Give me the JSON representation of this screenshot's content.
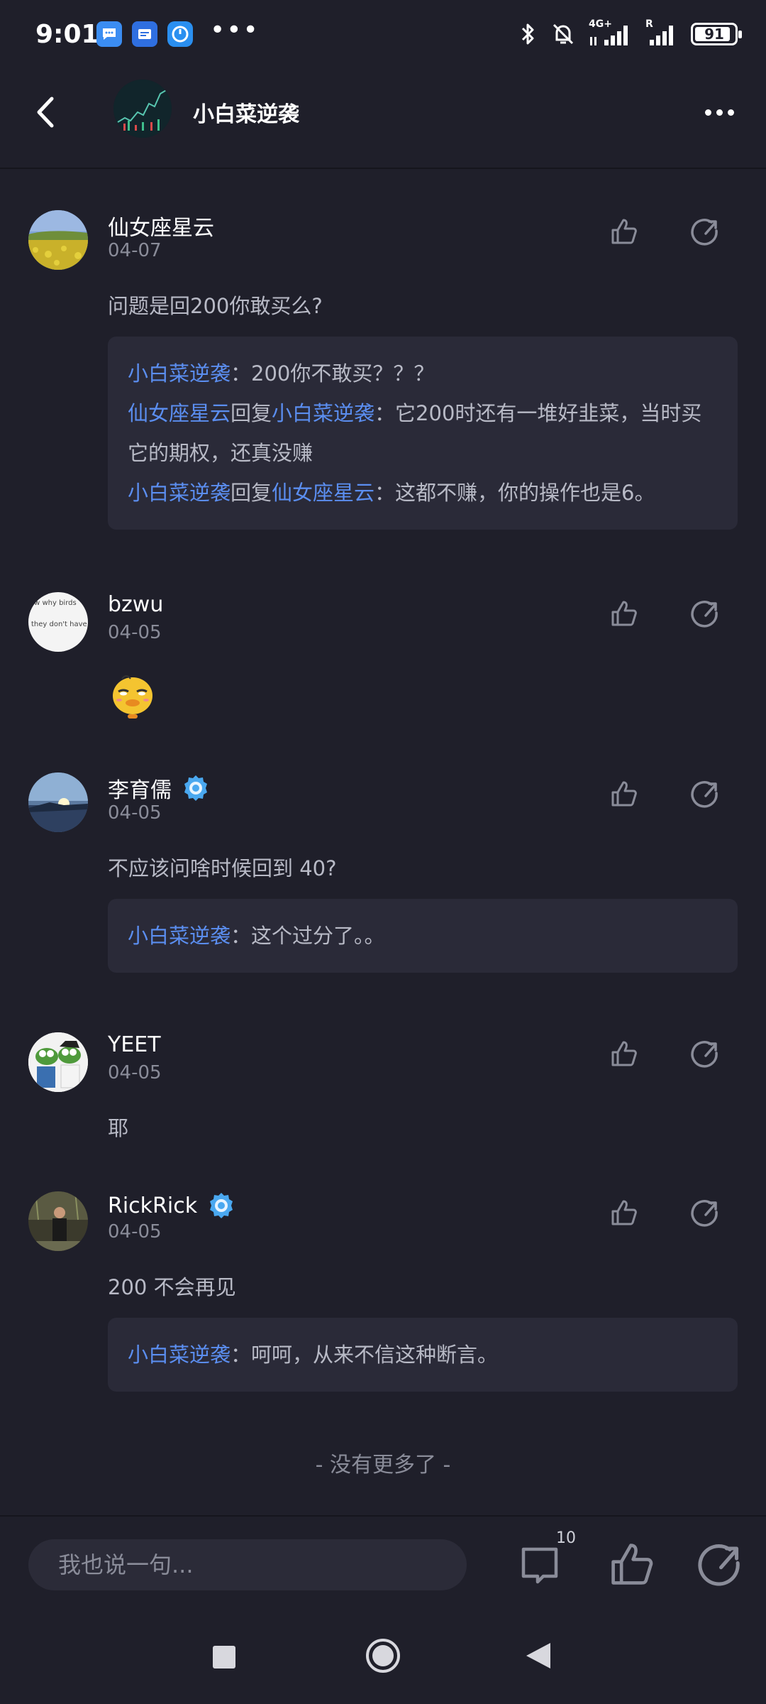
{
  "status_bar": {
    "time": "9:01",
    "app_icons": [
      "chat-app-icon",
      "message-app-icon",
      "timer-app-icon"
    ],
    "more": "•••",
    "network_1": "4G+",
    "network_2": "R",
    "battery": "91",
    "battery_level": 0.91
  },
  "header": {
    "title": "小白菜逆袭",
    "back_icon": "chevron-left-icon",
    "more_icon": "more-dots-icon"
  },
  "comments": [
    {
      "name": "仙女座星云",
      "date": "04-07",
      "verified": false,
      "text": "问题是回200你敢买么?",
      "replies": [
        {
          "from": "小白菜逆袭",
          "reply_word": "",
          "to": "",
          "text": "：200你不敢买？？？"
        },
        {
          "from": "仙女座星云",
          "reply_word": "回复",
          "to": "小白菜逆袭",
          "text": "：它200时还有一堆好韭菜，当时买它的期权，还真没赚"
        },
        {
          "from": "小白菜逆袭",
          "reply_word": "回复",
          "to": "仙女座星云",
          "text": "：这都不赚，你的操作也是6。"
        }
      ]
    },
    {
      "name": "bzwu",
      "date": "04-05",
      "verified": false,
      "avatar_text_1": "ow why birds",
      "avatar_text_2": "they don't have",
      "sticker": "smug-duck-sticker"
    },
    {
      "name": "李育儒",
      "date": "04-05",
      "verified": true,
      "text": "不应该问啥时候回到 40?",
      "replies": [
        {
          "from": "小白菜逆袭",
          "text": "：这个过分了。。"
        }
      ]
    },
    {
      "name": "YEET",
      "date": "04-05",
      "verified": false,
      "text": "耶"
    },
    {
      "name": "RickRick",
      "date": "04-05",
      "verified": true,
      "text": "200 不会再见",
      "replies": [
        {
          "from": "小白菜逆袭",
          "text": "：呵呵，从来不信这种断言。"
        }
      ]
    }
  ],
  "no_more": "- 没有更多了 -",
  "bottom_bar": {
    "placeholder": "我也说一句...",
    "comment_count": "10"
  },
  "colors": {
    "background": "#1f1f2a",
    "reply_box": "#2a2a38",
    "link_name": "#5b8ef0",
    "verify_badge": "#4aa8f0"
  }
}
